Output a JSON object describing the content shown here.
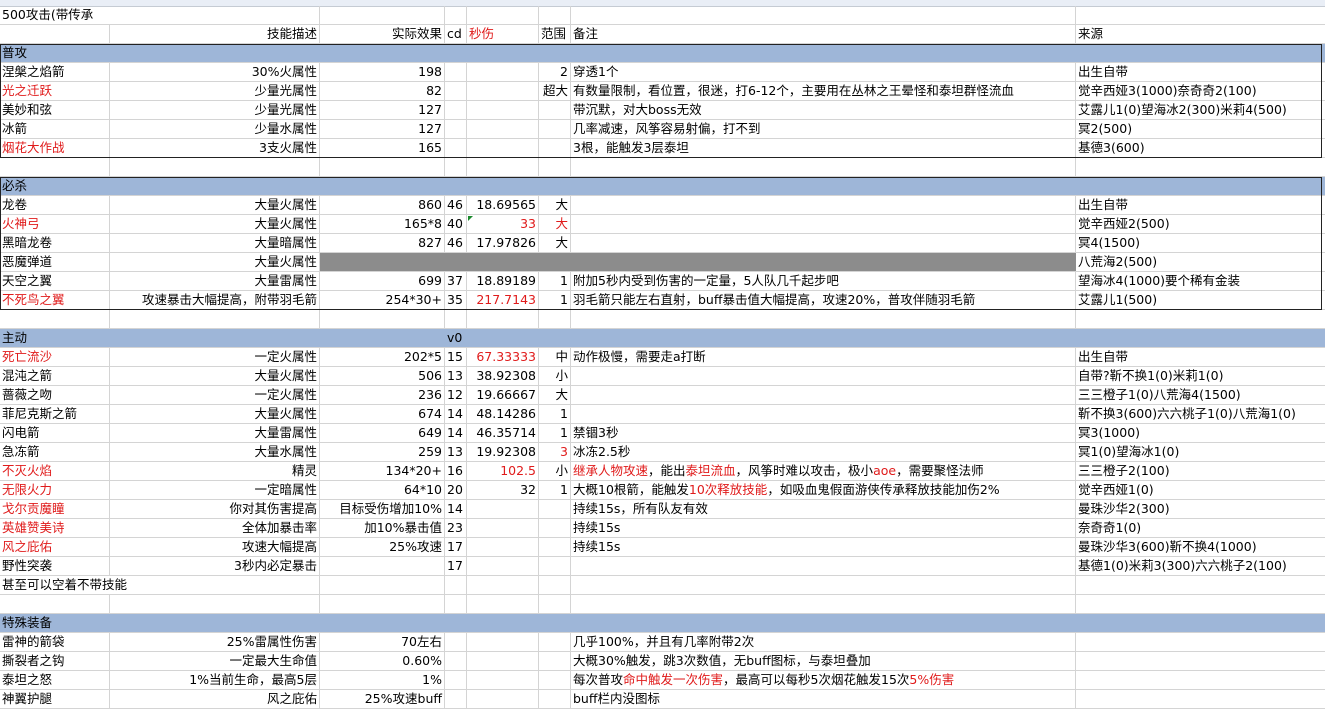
{
  "sheet": {
    "title": "500攻击(带传承",
    "headers": {
      "desc": "技能描述",
      "effect": "实际效果",
      "cd": "cd",
      "dps": "秒伤",
      "range": "范围",
      "note": "备注",
      "source": "来源"
    },
    "sections": {
      "basic": {
        "title": "普攻",
        "rows": [
          {
            "name": "涅槃之焰箭",
            "desc": "30%火属性",
            "effect": "198",
            "cd": "",
            "dps": "",
            "range": "2",
            "note": "穿透1个",
            "source": "出生自带",
            "name_red": false
          },
          {
            "name": "光之迁跃",
            "desc": "少量光属性",
            "effect": "82",
            "cd": "",
            "dps": "",
            "range": "超大",
            "note": "有数量限制，看位置，很迷，打6-12个，主要用在丛林之王晕怪和泰坦群怪流血",
            "source": "觉辛西娅3(1000)奈奇奇2(100)",
            "name_red": true
          },
          {
            "name": "美妙和弦",
            "desc": "少量光属性",
            "effect": "127",
            "cd": "",
            "dps": "",
            "range": "",
            "note": "带沉默，对大boss无效",
            "source": "艾露儿1(0)望海冰2(300)米莉4(500)",
            "name_red": false
          },
          {
            "name": "冰箭",
            "desc": "少量水属性",
            "effect": "127",
            "cd": "",
            "dps": "",
            "range": "",
            "note": "几率减速，风筝容易射偏，打不到",
            "source": "冥2(500)",
            "name_red": false
          },
          {
            "name": "烟花大作战",
            "desc": "3支火属性",
            "effect": "165",
            "cd": "",
            "dps": "",
            "range": "",
            "note": "3根，能触发3层泰坦",
            "source": "基德3(600)",
            "name_red": true
          }
        ]
      },
      "ult": {
        "title": "必杀",
        "rows": [
          {
            "name": "龙卷",
            "desc": "大量火属性",
            "effect": "860",
            "cd": "46",
            "dps": "18.69565",
            "range": "大",
            "note": "",
            "source": "出生自带",
            "name_red": false,
            "dps_red": false,
            "range_red": false
          },
          {
            "name": "火神弓",
            "desc": "大量火属性",
            "effect": "165*8",
            "cd": "40",
            "dps": "33",
            "range": "大",
            "note": "",
            "source": "觉辛西娅2(500)",
            "name_red": true,
            "dps_red": true,
            "range_red": true
          },
          {
            "name": "黑暗龙卷",
            "desc": "大量暗属性",
            "effect": "827",
            "cd": "46",
            "dps": "17.97826",
            "range": "大",
            "note": "",
            "source": "冥4(1500)",
            "name_red": false,
            "dps_red": false,
            "range_red": false
          },
          {
            "name": "恶魔弹道",
            "desc": "大量火属性",
            "effect": "",
            "cd": "",
            "dps": "",
            "range": "",
            "note": "",
            "source": "八荒海2(500)",
            "name_red": false,
            "dps_red": false,
            "range_red": false
          },
          {
            "name": "天空之翼",
            "desc": "大量雷属性",
            "effect": "699",
            "cd": "37",
            "dps": "18.89189",
            "range": "1",
            "note": "附加5秒内受到伤害的一定量，5人队几千起步吧",
            "source": "望海冰4(1000)要个稀有金装",
            "name_red": false,
            "dps_red": false,
            "range_red": false
          },
          {
            "name": "不死鸟之翼",
            "desc": "攻速暴击大幅提高，附带羽毛箭",
            "effect": "254*30+",
            "cd": "35",
            "dps": "217.7143",
            "range": "1",
            "note": "羽毛箭只能左右直射，buff暴击值大幅提高，攻速20%，普攻伴随羽毛箭",
            "source": "艾露儿1(500)",
            "name_red": true,
            "dps_red": true,
            "range_red": false
          }
        ]
      },
      "active": {
        "title": "主动",
        "cd_label": "v0",
        "rows": [
          {
            "name": "死亡流沙",
            "desc": "一定火属性",
            "effect": "202*5",
            "cd": "15",
            "dps": "67.33333",
            "range": "中",
            "note": "动作极慢，需要走a打断",
            "source": "出生自带",
            "name_red": true,
            "dps_red": true
          },
          {
            "name": "混沌之箭",
            "desc": "大量火属性",
            "effect": "506",
            "cd": "13",
            "dps": "38.92308",
            "range": "小",
            "note": "",
            "source": "自带?靳不换1(0)米莉1(0)",
            "name_red": false,
            "dps_red": false
          },
          {
            "name": "蔷薇之吻",
            "desc": "一定火属性",
            "effect": "236",
            "cd": "12",
            "dps": "19.66667",
            "range": "大",
            "note": "",
            "source": "三三橙子1(0)八荒海4(1500)",
            "name_red": false,
            "dps_red": false
          },
          {
            "name": "菲尼克斯之箭",
            "desc": "大量火属性",
            "effect": "674",
            "cd": "14",
            "dps": "48.14286",
            "range": "1",
            "note": "",
            "source": "靳不换3(600)六六桃子1(0)八荒海1(0)",
            "name_red": false,
            "dps_red": false
          },
          {
            "name": "闪电箭",
            "desc": "大量雷属性",
            "effect": "649",
            "cd": "14",
            "dps": "46.35714",
            "range": "1",
            "note": "禁锢3秒",
            "source": "冥3(1000)",
            "name_red": false,
            "dps_red": false
          },
          {
            "name": "急冻箭",
            "desc": "大量水属性",
            "effect": "259",
            "cd": "13",
            "dps": "19.92308",
            "range": "3",
            "note": "冰冻2.5秒",
            "source": "冥1(0)望海冰1(0)",
            "name_red": false,
            "dps_red": false,
            "range_red": true
          },
          {
            "name": "不灭火焰",
            "desc": "精灵",
            "effect": "134*20+",
            "cd": "16",
            "dps": "102.5",
            "range": "小",
            "note_parts": [
              {
                "t": "继承人物攻速",
                "red": true
              },
              {
                "t": "，能出",
                "red": false
              },
              {
                "t": "泰坦流血",
                "red": true
              },
              {
                "t": "，风筝时难以攻击，极小",
                "red": false
              },
              {
                "t": "aoe",
                "red": true
              },
              {
                "t": "，需要聚怪法师",
                "red": false
              }
            ],
            "source": "三三橙子2(100)",
            "name_red": true,
            "dps_red": true
          },
          {
            "name": "无限火力",
            "desc": "一定暗属性",
            "effect": "64*10",
            "cd": "20",
            "dps": "32",
            "range": "1",
            "note_parts": [
              {
                "t": "大概10根箭，能触发",
                "red": false
              },
              {
                "t": "10次释放技能",
                "red": true
              },
              {
                "t": "，如吸血鬼假面游侠传承释放技能加伤2%",
                "red": false
              }
            ],
            "source": "觉辛西娅1(0)",
            "name_red": true,
            "dps_red": false
          },
          {
            "name": "戈尔贡魔瞳",
            "desc": "你对其伤害提高",
            "effect": "目标受伤增加10%",
            "cd": "14",
            "dps": "",
            "range": "",
            "note": "持续15s，所有队友有效",
            "source": "曼珠沙华2(300)",
            "name_red": true,
            "dps_red": false
          },
          {
            "name": "英雄赞美诗",
            "desc": "全体加暴击率",
            "effect": "加10%暴击值",
            "cd": "23",
            "dps": "",
            "range": "",
            "note": "持续15s",
            "source": "奈奇奇1(0)",
            "name_red": true,
            "dps_red": false
          },
          {
            "name": "风之庇佑",
            "desc": "攻速大幅提高",
            "effect": "25%攻速",
            "cd": "17",
            "dps": "",
            "range": "",
            "note": "持续15s",
            "source": "曼珠沙华3(600)靳不换4(1000)",
            "name_red": true,
            "dps_red": false
          },
          {
            "name": "野性突袭",
            "desc": "3秒内必定暴击",
            "effect": "",
            "cd": "17",
            "dps": "",
            "range": "",
            "note": "",
            "source": "基德1(0)米莉3(300)六六桃子2(100)",
            "name_red": false,
            "dps_red": false
          }
        ],
        "footer": "甚至可以空着不带技能"
      },
      "equip": {
        "title": "特殊装备",
        "rows": [
          {
            "name": "雷神的箭袋",
            "desc": "25%雷属性伤害",
            "effect": "70左右",
            "note_parts": [
              {
                "t": "几乎100%，并且有几率附带2次",
                "red": false
              }
            ]
          },
          {
            "name": "撕裂者之钩",
            "desc": "一定最大生命值",
            "effect": "0.60%",
            "note_parts": [
              {
                "t": "大概30%触发，跳3次数值，无buff图标，与泰坦叠加",
                "red": false
              }
            ]
          },
          {
            "name": "泰坦之怒",
            "desc": "1%当前生命，最高5层",
            "effect": "1%",
            "note_parts": [
              {
                "t": "每次普攻",
                "red": false
              },
              {
                "t": "命中触发一次伤害",
                "red": true
              },
              {
                "t": "，最高可以每秒5次烟花触发15次",
                "red": false
              },
              {
                "t": "5%伤害",
                "red": true
              }
            ]
          },
          {
            "name": "神翼护腿",
            "desc": "风之庇佑",
            "effect": "25%攻速buff",
            "note_parts": [
              {
                "t": "buff栏内没图标",
                "red": false
              }
            ]
          }
        ]
      }
    }
  }
}
